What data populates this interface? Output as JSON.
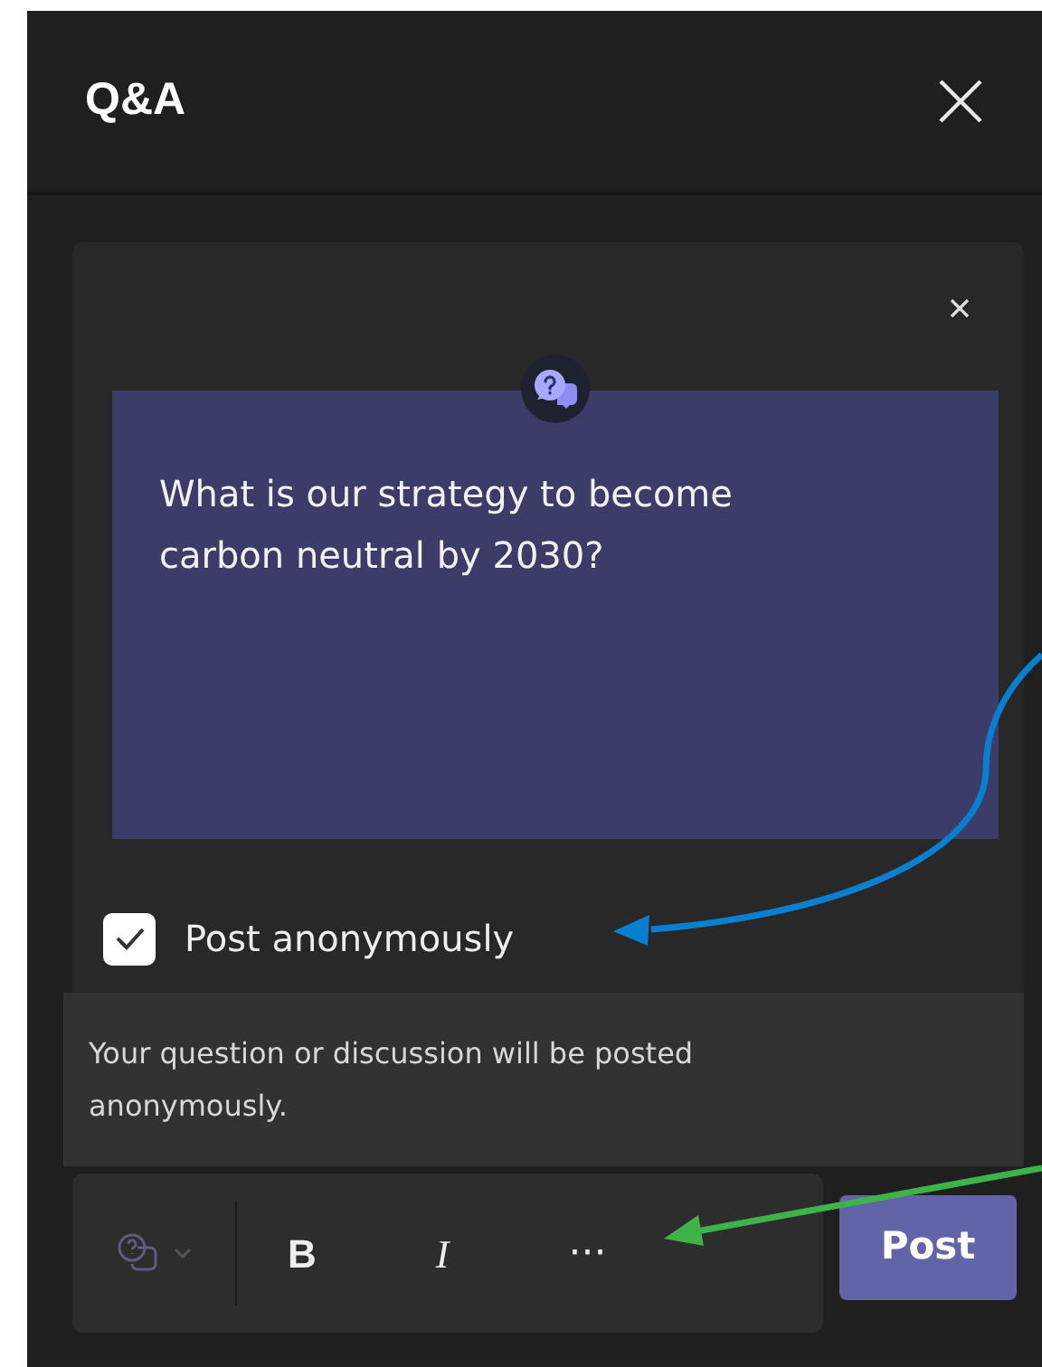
{
  "panel": {
    "title": "Q&A"
  },
  "compose": {
    "question": "What is our strategy to become carbon neutral by 2030?",
    "anonymous": {
      "label": "Post anonymously",
      "checked": true
    },
    "notice": "Your question or discussion will be posted anonymously."
  },
  "toolbar": {
    "buttons": [
      {
        "kind": "bold",
        "label": "B"
      },
      {
        "kind": "italic",
        "label": "I"
      },
      {
        "kind": "more",
        "label": "···"
      }
    ]
  },
  "post_button": "Post"
}
